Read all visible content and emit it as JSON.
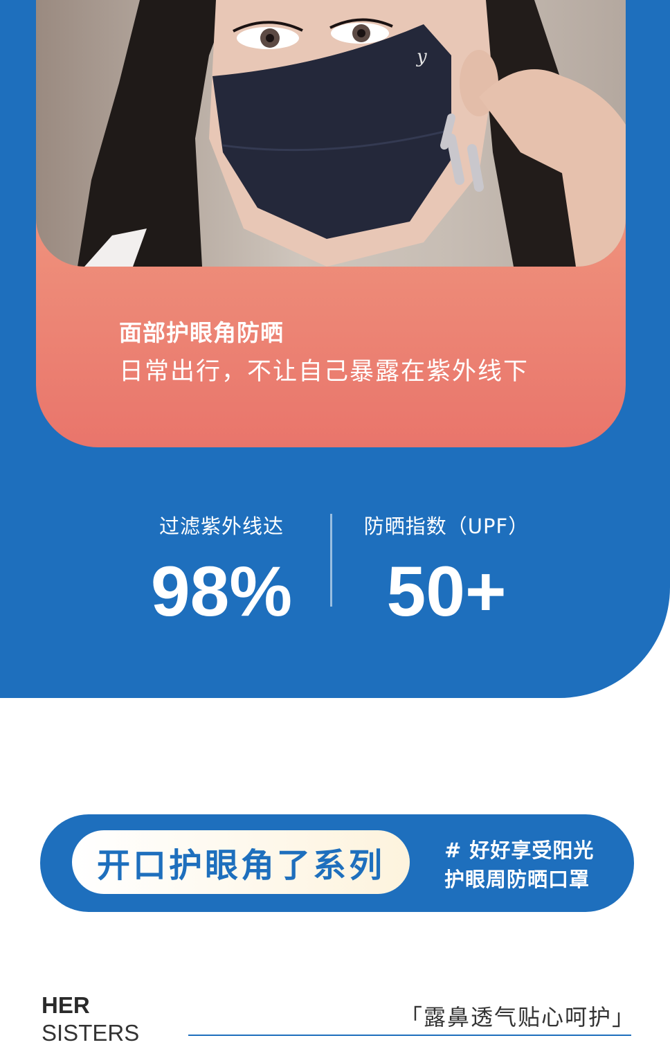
{
  "card": {
    "title": "面部护眼角防晒",
    "subtitle": "日常出行，不让自己暴露在紫外线下"
  },
  "stats": [
    {
      "label": "过滤紫外线达",
      "value": "98%"
    },
    {
      "label": "防晒指数（UPF）",
      "value": "50+"
    }
  ],
  "series": {
    "name": "开口护眼角了系列",
    "tag_line1": "# 好好享受阳光",
    "tag_line2": "护眼周防晒口罩"
  },
  "footer": {
    "brand_line1": "HER",
    "brand_line2": "SISTERS",
    "quote": "「露鼻透气贴心呵护」"
  },
  "colors": {
    "brand_blue": "#1e6fbd",
    "card_coral": "#ee8e7a",
    "pill_cream": "#fdf3dd"
  }
}
